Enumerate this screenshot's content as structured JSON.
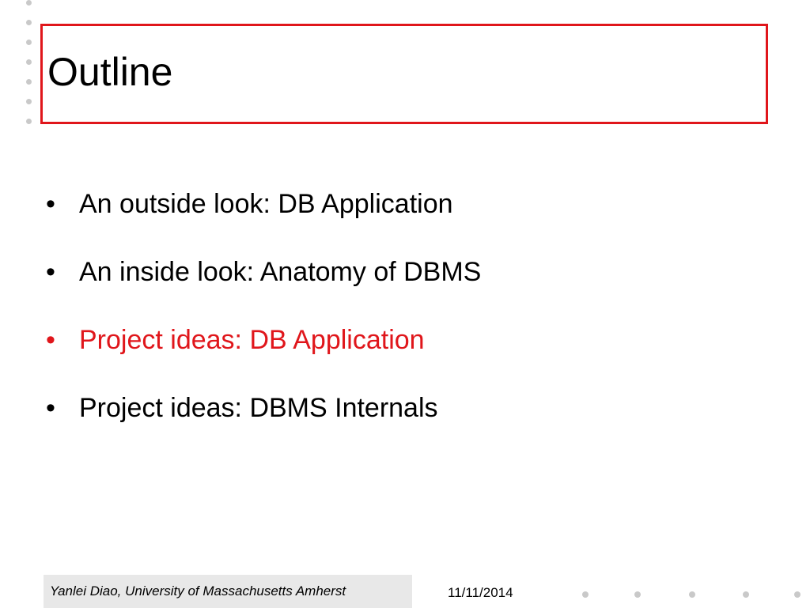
{
  "slide": {
    "title": "Outline",
    "bullets": [
      {
        "marker": "•",
        "text": "An outside look: DB Application"
      },
      {
        "marker": "•",
        "text": "An inside look: Anatomy of DBMS"
      },
      {
        "marker": "•",
        "text": "Project ideas: DB Application"
      },
      {
        "marker": "•",
        "text": "Project ideas: DBMS Internals"
      }
    ],
    "highlight_color": "#e0161b",
    "frame_color": "#e0161b"
  },
  "footer": {
    "author": "Yanlei Diao, University of Massachusetts Amherst",
    "date": "11/11/2014"
  }
}
